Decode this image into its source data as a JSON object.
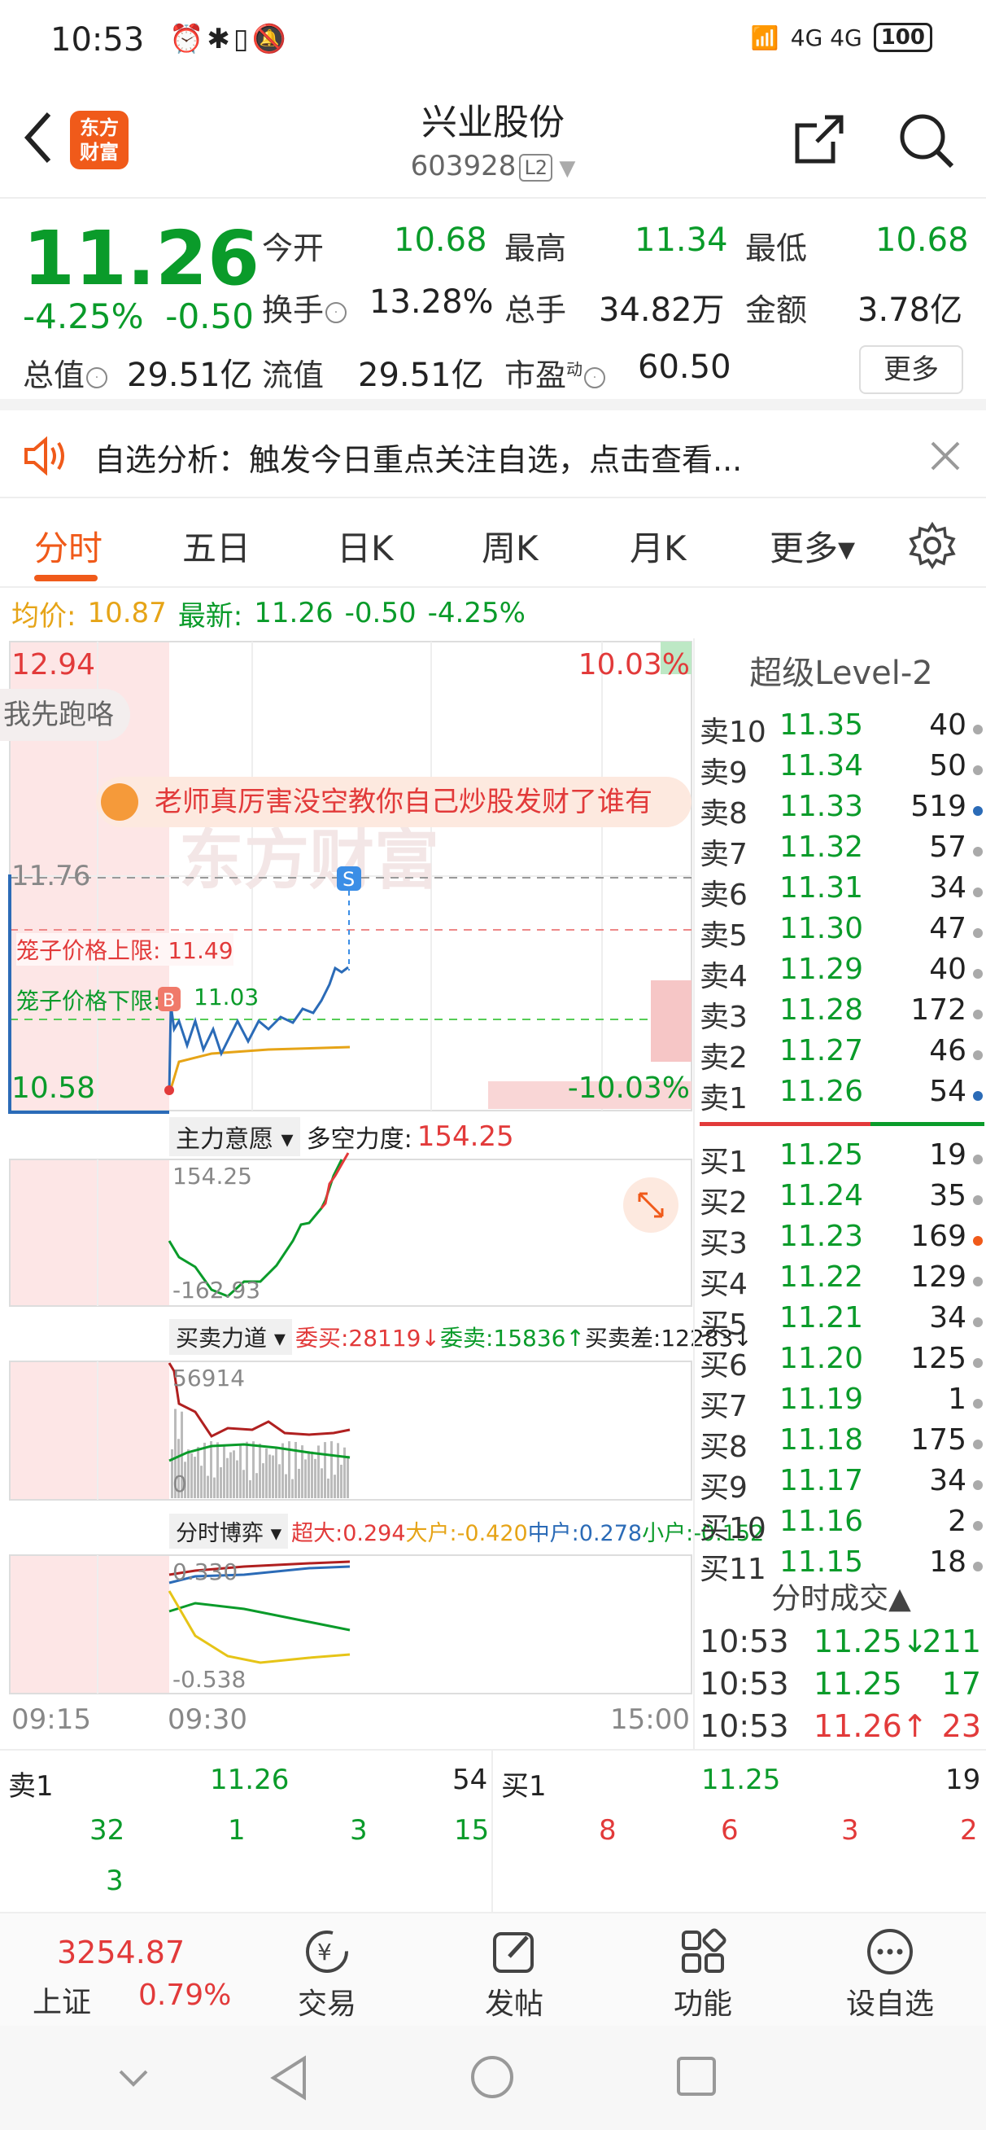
{
  "status_bar": {
    "time": "10:53",
    "left_icons": "⏰✱▯🔕",
    "network": "4G 4G",
    "battery": "100"
  },
  "header": {
    "title": "兴业股份",
    "code": "603928",
    "level": "L2",
    "logo_text": "东方\n财富"
  },
  "quote": {
    "price": "11.26",
    "change_pct": "-4.25%",
    "change": "-0.50",
    "open_label": "今开",
    "open": "10.68",
    "high_label": "最高",
    "high": "11.34",
    "low_label": "最低",
    "low": "10.68",
    "turnover_label": "换手",
    "turnover": "13.28%",
    "volume_label": "总手",
    "volume": "34.82万",
    "amount_label": "金额",
    "amount": "3.78亿",
    "mcap_label": "总值",
    "mcap": "29.51亿",
    "float_label": "流值",
    "float": "29.51亿",
    "pe_label": "市盈",
    "pe_sup": "动",
    "pe": "60.50",
    "more": "更多"
  },
  "notice": {
    "text": "自选分析：触发今日重点关注自选，点击查看..."
  },
  "tabs": [
    "分时",
    "五日",
    "日K",
    "周K",
    "月K",
    "更多▾"
  ],
  "avg": {
    "label": "均价:",
    "value": "10.87",
    "latest_label": "最新:",
    "latest": "11.26",
    "chg": "-0.50",
    "pct": "-4.25%"
  },
  "chart": {
    "top_price": "12.94",
    "top_pct": "10.03%",
    "bottom_price": "10.58",
    "bottom_pct": "-10.03%",
    "mid_line": "11.76",
    "popup": "我先跑咯",
    "danmaku": "老师真厉害没空教你自己炒股发财了谁有",
    "watermark": "东方财富",
    "cage_upper_label": "笼子价格上限:",
    "cage_upper": "11.49",
    "cage_lower_label": "笼子价格下限:",
    "cage_lower": "11.03",
    "marker_s": "S",
    "marker_b": "B",
    "ind1_name": "主力意愿",
    "ind1_label": "多空力度:",
    "ind1_value": "154.25",
    "ind1_max": "154.25",
    "ind1_min": "-162.93",
    "ind2_name": "买卖力道",
    "ind2_buy": "委买:28119↓",
    "ind2_sell": "委卖:15836↑",
    "ind2_diff": "买卖差:12283↓",
    "ind2_max": "56914",
    "ind2_min": "0",
    "ind3_name": "分时博弈",
    "ind3_super": "超大:0.294",
    "ind3_big": "大户:-0.420",
    "ind3_mid": "中户:0.278",
    "ind3_small": "小户:-0.152",
    "ind3_max": "0.330",
    "ind3_min": "-0.538",
    "time_start": "09:15",
    "time_open": "09:30",
    "time_end": "15:00"
  },
  "level2": {
    "title": "超级Level-2",
    "asks": [
      {
        "name": "卖10",
        "price": "11.35",
        "vol": "40",
        "dot": "gray"
      },
      {
        "name": "卖9",
        "price": "11.34",
        "vol": "50",
        "dot": "gray"
      },
      {
        "name": "卖8",
        "price": "11.33",
        "vol": "519",
        "dot": "blue"
      },
      {
        "name": "卖7",
        "price": "11.32",
        "vol": "57",
        "dot": "gray"
      },
      {
        "name": "卖6",
        "price": "11.31",
        "vol": "34",
        "dot": "gray"
      },
      {
        "name": "卖5",
        "price": "11.30",
        "vol": "47",
        "dot": "gray"
      },
      {
        "name": "卖4",
        "price": "11.29",
        "vol": "40",
        "dot": "gray"
      },
      {
        "name": "卖3",
        "price": "11.28",
        "vol": "172",
        "dot": "gray"
      },
      {
        "name": "卖2",
        "price": "11.27",
        "vol": "46",
        "dot": "gray"
      },
      {
        "name": "卖1",
        "price": "11.26",
        "vol": "54",
        "dot": "blue"
      }
    ],
    "bids": [
      {
        "name": "买1",
        "price": "11.25",
        "vol": "19",
        "dot": "gray"
      },
      {
        "name": "买2",
        "price": "11.24",
        "vol": "35",
        "dot": "gray"
      },
      {
        "name": "买3",
        "price": "11.23",
        "vol": "169",
        "dot": "orange"
      },
      {
        "name": "买4",
        "price": "11.22",
        "vol": "129",
        "dot": "gray"
      },
      {
        "name": "买5",
        "price": "11.21",
        "vol": "34",
        "dot": "gray"
      },
      {
        "name": "买6",
        "price": "11.20",
        "vol": "125",
        "dot": "gray"
      },
      {
        "name": "买7",
        "price": "11.19",
        "vol": "1",
        "dot": "gray"
      },
      {
        "name": "买8",
        "price": "11.18",
        "vol": "175",
        "dot": "gray"
      },
      {
        "name": "买9",
        "price": "11.17",
        "vol": "34",
        "dot": "gray"
      },
      {
        "name": "买10",
        "price": "11.16",
        "vol": "2",
        "dot": "gray"
      },
      {
        "name": "买11",
        "price": "11.15",
        "vol": "18",
        "dot": "gray"
      }
    ],
    "trades_title": "分时成交▲",
    "trades": [
      {
        "time": "10:53",
        "price": "11.25↓",
        "vol": "211",
        "color": "g"
      },
      {
        "time": "10:53",
        "price": "11.25",
        "vol": "17",
        "color": "g"
      },
      {
        "time": "10:53",
        "price": "11.26↑",
        "vol": "23",
        "color": "r"
      }
    ]
  },
  "bottom_queue": {
    "sell_label": "卖1",
    "sell_price": "11.26",
    "sell_vol": "54",
    "buy_label": "买1",
    "buy_price": "11.25",
    "buy_vol": "19",
    "sell_orders": [
      "32",
      "1",
      "3",
      "15"
    ],
    "sell_orders_row2": [
      "3"
    ],
    "buy_orders": [
      "8",
      "6",
      "3",
      "2"
    ]
  },
  "bottom_nav": {
    "index_value": "3254.87",
    "index_name": "上证",
    "index_pct": "0.79%",
    "items": [
      "交易",
      "发帖",
      "功能",
      "设自选"
    ]
  },
  "colors": {
    "up": "#e23a3a",
    "down": "#0a9b2a",
    "accent": "#f05a1a",
    "avg_line": "#e6a417",
    "price_line": "#2b6bb7"
  }
}
